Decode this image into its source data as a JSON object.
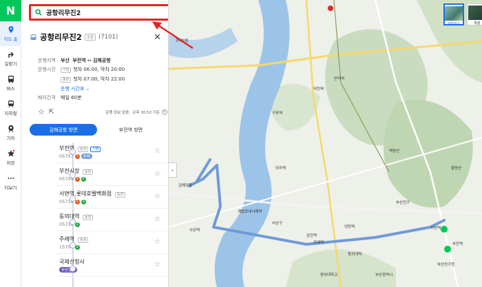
{
  "rail": {
    "logo": "N",
    "items": [
      {
        "label": "지도 홈",
        "icon": "pin-icon"
      },
      {
        "label": "길찾기",
        "icon": "directions-icon"
      },
      {
        "label": "버스",
        "icon": "bus-icon"
      },
      {
        "label": "지하철",
        "icon": "subway-icon"
      },
      {
        "label": "기차",
        "icon": "train-icon"
      },
      {
        "label": "저장",
        "icon": "star-icon"
      },
      {
        "label": "더보기",
        "icon": "more-icon"
      }
    ]
  },
  "search": {
    "query": "공항리무진2"
  },
  "route": {
    "name": "공항리무진2",
    "badge": "공항",
    "number": "(7101)",
    "area_label": "운행지역",
    "area_from": "부산",
    "area_mid": "부전역",
    "area_arrow": "↔",
    "area_to": "김해공항",
    "hours_label": "운행시간",
    "hours_weekday_tag": "기점",
    "hours_weekday": "첫차 06:00, 막차 20:00",
    "hours_end_tag": "종점",
    "hours_end": "첫차 07:00, 막차 22:00",
    "timetable_link": "운행 시간표",
    "interval_label": "배차간격",
    "interval": "매일 60분",
    "update_text": "운행 정보 없음 · 오후 10:52 기준",
    "tab_active": "김해공항 방면",
    "tab_other": "부전역 방면"
  },
  "stops": [
    {
      "name": "부전역",
      "tags": [
        "동양",
        "기점"
      ],
      "code": "05707",
      "lines": [
        {
          "txt": "1",
          "color": "#e05a28"
        },
        {
          "txt": "동해",
          "color": "#6f9bd6",
          "pill": true
        }
      ]
    },
    {
      "name": "부전시장",
      "tags": [
        "동양"
      ],
      "code": "05709",
      "lines": [
        {
          "txt": "1",
          "color": "#e05a28"
        },
        {
          "txt": "2",
          "color": "#2aa448"
        }
      ]
    },
    {
      "name": "서면역.롯데호텔백화점",
      "tags": [
        "동양"
      ],
      "code": "05718",
      "lines": [
        {
          "txt": "1",
          "color": "#e05a28"
        },
        {
          "txt": "2",
          "color": "#2aa448"
        }
      ]
    },
    {
      "name": "동의대역",
      "tags": [
        "동양"
      ],
      "code": "05726",
      "lines": [
        {
          "txt": "2",
          "color": "#2aa448"
        }
      ]
    },
    {
      "name": "주례역",
      "tags": [
        "동양"
      ],
      "code": "15706",
      "lines": [
        {
          "txt": "2",
          "color": "#2aa448"
        }
      ]
    },
    {
      "name": "국제선청사",
      "tags": [],
      "code": "",
      "lines": [
        {
          "txt": "부산김해",
          "color": "#6a58b8",
          "pill": true
        }
      ]
    }
  ],
  "map": {
    "types": [
      "일반지도",
      "위성"
    ],
    "labels": [
      {
        "t": "주례2동"
      },
      {
        "t": "주례역"
      },
      {
        "t": "서면역"
      },
      {
        "t": "부산진구"
      },
      {
        "t": "백양산"
      },
      {
        "t": "김해공항"
      },
      {
        "t": "사상구"
      },
      {
        "t": "동의대역"
      },
      {
        "t": "부산진구청"
      },
      {
        "t": "괘법르네시떼역"
      },
      {
        "t": "사상역"
      },
      {
        "t": "냉정역"
      },
      {
        "t": "감전역"
      },
      {
        "t": "덕천역"
      },
      {
        "t": "구포역"
      },
      {
        "t": "모라역"
      },
      {
        "t": "만덕역"
      },
      {
        "t": "동아대학교"
      },
      {
        "t": "부산광역시"
      },
      {
        "t": "부전역"
      },
      {
        "t": "황령산"
      }
    ]
  }
}
